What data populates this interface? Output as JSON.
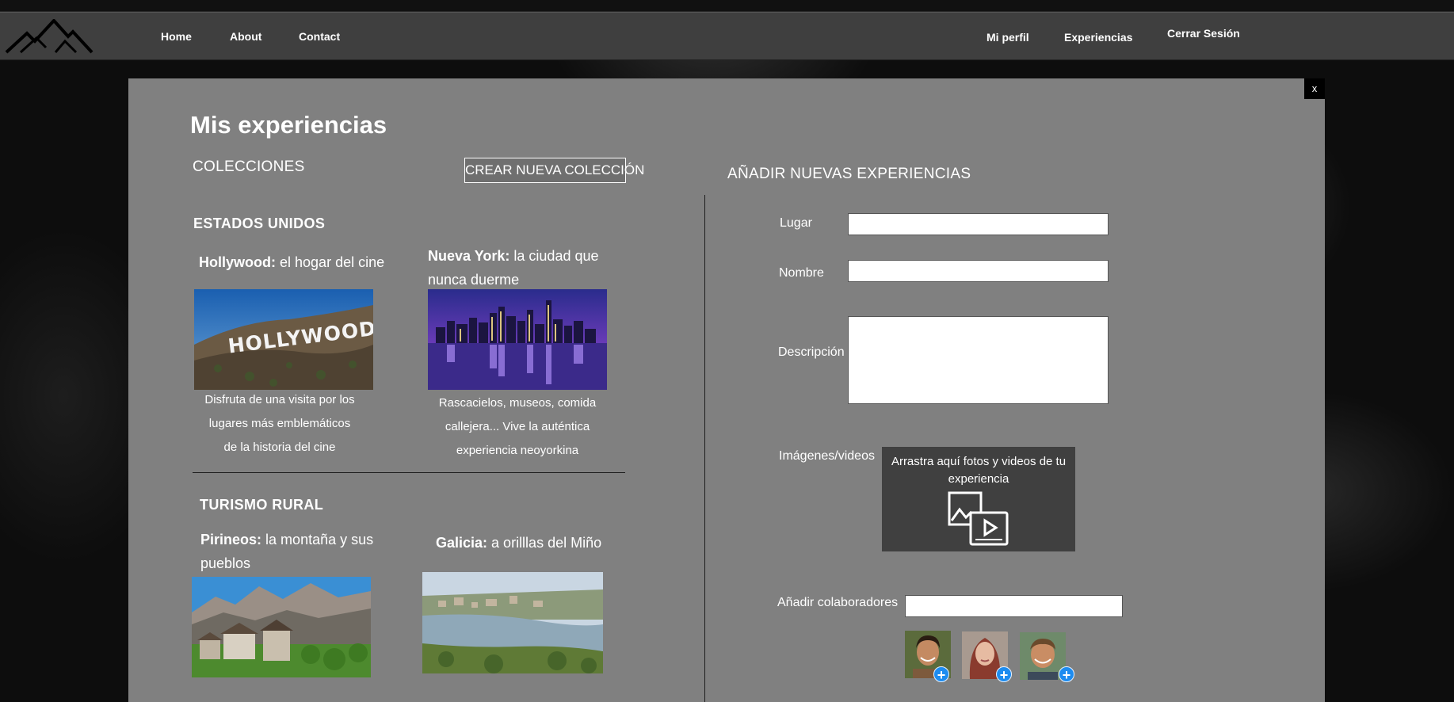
{
  "nav": {
    "left": [
      "Home",
      "About",
      "Contact"
    ],
    "right": {
      "profile": "Mi perfil",
      "experiences": "Experiencias",
      "logout": "Cerrar Sesión"
    }
  },
  "modal": {
    "close_label": "x",
    "title": "Mis experiencias"
  },
  "collections": {
    "label": "COLECCIONES",
    "new_button": "CREAR NUEVA COLECCIÓN",
    "groups": [
      {
        "title": "ESTADOS UNIDOS",
        "items": [
          {
            "place": "Hollywood:",
            "tagline": "el hogar del cine",
            "image": "hollywood-sign",
            "description": "Disfruta de una visita por los lugares más emblemáticos de la historia del cine"
          },
          {
            "place": "Nueva York:",
            "tagline": "la ciudad que nunca duerme",
            "image": "new-york-skyline",
            "description": "Rascacielos, museos, comida callejera... Vive la auténtica experiencia neoyorkina"
          }
        ]
      },
      {
        "title": "TURISMO RURAL",
        "items": [
          {
            "place": "Pirineos:",
            "tagline": "la montaña y sus pueblos",
            "image": "pyrenees-village"
          },
          {
            "place": "Galicia:",
            "tagline": "a orilllas del Miño",
            "image": "galicia-river"
          }
        ]
      }
    ]
  },
  "form": {
    "title": "AÑADIR NUEVAS EXPERIENCIAS",
    "place_label": "Lugar",
    "place_value": "",
    "name_label": "Nombre",
    "name_value": "",
    "description_label": "Descripción",
    "description_value": "",
    "media_label": "Imágenes/videos",
    "dropzone_text": "Arrastra aquí fotos y videos de tu experiencia",
    "dropzone_icon": "image-video-icon",
    "collaborators_label": "Añadir colaboradores",
    "collaborators_value": "",
    "collaborators": [
      {
        "name": "collaborator-1",
        "add": "+"
      },
      {
        "name": "collaborator-2",
        "add": "+"
      },
      {
        "name": "collaborator-3",
        "add": "+"
      }
    ]
  },
  "colors": {
    "panel": "#808080",
    "navbar": "#3f3f3f",
    "dropzone": "#404040",
    "add_badge": "#1d8cf0"
  }
}
